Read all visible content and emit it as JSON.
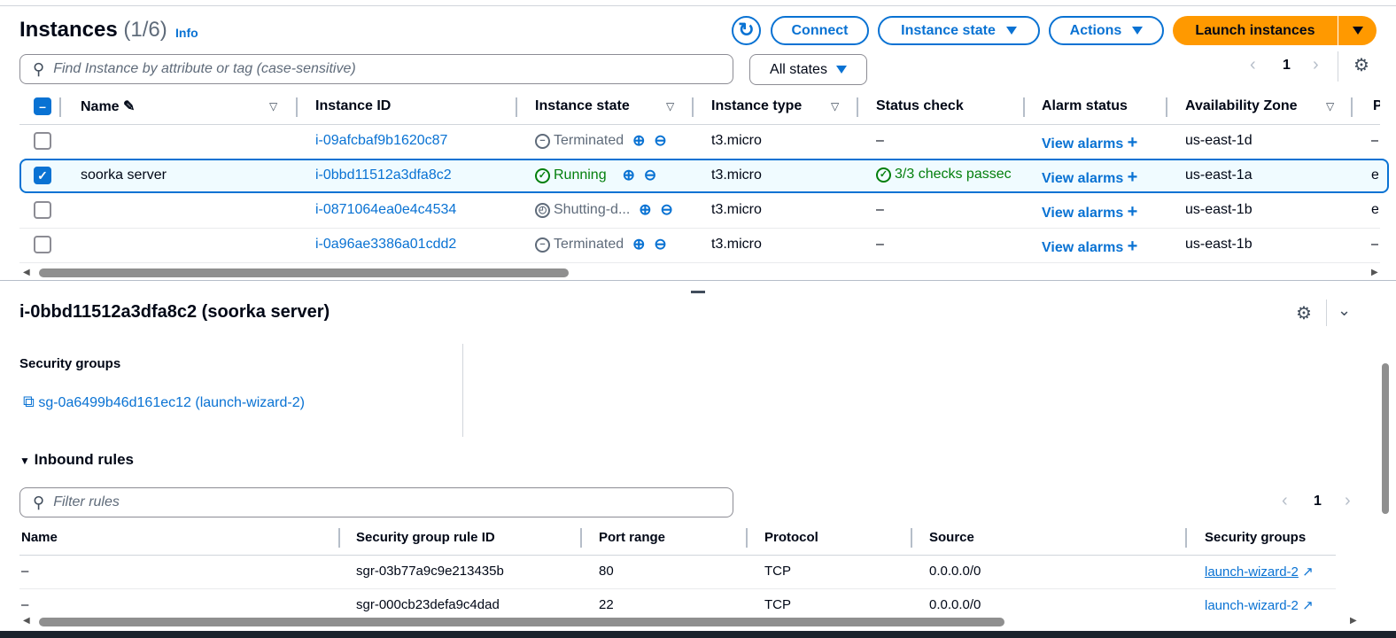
{
  "header": {
    "title": "Instances",
    "count": "(1/6)",
    "info": "Info"
  },
  "toolbar": {
    "connect": "Connect",
    "instance_state": "Instance state",
    "actions": "Actions",
    "launch": "Launch instances"
  },
  "search": {
    "placeholder": "Find Instance by attribute or tag (case-sensitive)",
    "filter": "All states"
  },
  "pagination": {
    "page": "1"
  },
  "columns": [
    "Name",
    "Instance ID",
    "Instance state",
    "Instance type",
    "Status check",
    "Alarm status",
    "Availability Zone",
    "P"
  ],
  "rows": [
    {
      "name": "",
      "id": "i-09afcbaf9b1620c87",
      "state": "Terminated",
      "type": "t3.micro",
      "status": "–",
      "alarm": "View alarms",
      "az": "us-east-1d",
      "extra": "–",
      "selected": false
    },
    {
      "name": "soorka server",
      "id": "i-0bbd11512a3dfa8c2",
      "state": "Running",
      "type": "t3.micro",
      "status": "3/3 checks passec",
      "alarm": "View alarms",
      "az": "us-east-1a",
      "extra": "e",
      "selected": true
    },
    {
      "name": "",
      "id": "i-0871064ea0e4c4534",
      "state": "Shutting-d...",
      "type": "t3.micro",
      "status": "–",
      "alarm": "View alarms",
      "az": "us-east-1b",
      "extra": "e",
      "selected": false
    },
    {
      "name": "",
      "id": "i-0a96ae3386a01cdd2",
      "state": "Terminated",
      "type": "t3.micro",
      "status": "–",
      "alarm": "View alarms",
      "az": "us-east-1b",
      "extra": "–",
      "selected": false
    }
  ],
  "details": {
    "title": "i-0bbd11512a3dfa8c2 (soorka server)",
    "sg_label": "Security groups",
    "sg_link": "sg-0a6499b46d161ec12 (launch-wizard-2)",
    "inbound": "Inbound rules",
    "filter_placeholder": "Filter rules",
    "page": "1"
  },
  "rules_columns": [
    "Name",
    "Security group rule ID",
    "Port range",
    "Protocol",
    "Source",
    "Security groups"
  ],
  "rules": [
    {
      "name": "–",
      "id": "sgr-03b77a9c9e213435b",
      "port": "80",
      "protocol": "TCP",
      "source": "0.0.0.0/0",
      "sg": "launch-wizard-2"
    },
    {
      "name": "–",
      "id": "sgr-000cb23defa9c4dad",
      "port": "22",
      "protocol": "TCP",
      "source": "0.0.0.0/0",
      "sg": "launch-wizard-2"
    }
  ],
  "colors": {
    "accent": "#0972d3",
    "launch": "#ff9900",
    "success": "#037f0c"
  }
}
